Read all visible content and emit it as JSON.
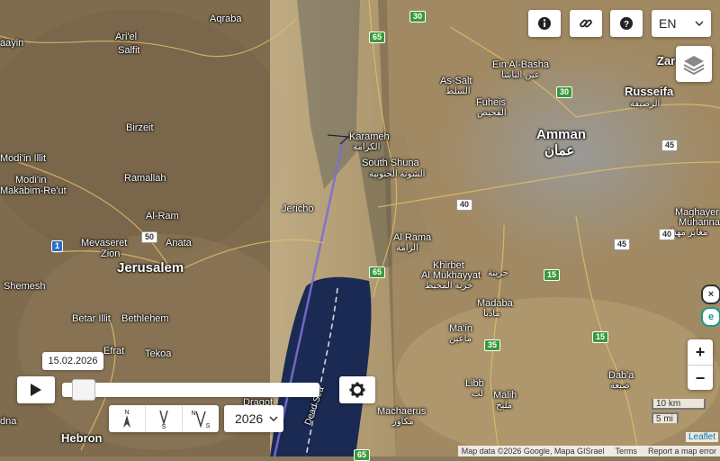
{
  "map": {
    "labels": {
      "aqraba": "Aqraba",
      "arjel": "Ari'el",
      "salfit": "Salfit",
      "ayin": "aayin",
      "birzeit": "Birzeit",
      "modin_illit": "Modi'in Illit",
      "modin": "Modi'in",
      "makabim": "Makabim-Re'ut",
      "ramallah": "Ramallah",
      "alram": "Al-Ram",
      "anata": "Anata",
      "mevaseret": "Mevaseret",
      "zion": "Zion",
      "jerusalem": "Jerusalem",
      "shemesh": "Shemesh",
      "betar": "Betar Illit",
      "bethlehem": "Bethlehem",
      "efrat": "Efrat",
      "tekoa": "Tekoa",
      "dragot": "Dragot",
      "hebron": "Hebron",
      "dna": "dna",
      "jericho": "Jericho",
      "karameh": "Karameh",
      "karameh_ar": "الكرامة",
      "southshuna": "South Shuna",
      "southshuna_ar": "الشونة الجنوبية",
      "alrama": "Al Rama",
      "alrama_ar": "الرامة",
      "khirbet": "Khirbet",
      "almukhayyat": "Al Mukhayyat",
      "khirbet_ar": "خربة المخيط",
      "jarina_ar": "جرينة",
      "madaba": "Madaba",
      "madaba_ar": "مادبا",
      "main": "Ma'in",
      "main_ar": "ماعين",
      "libb": "Libb",
      "libb_ar": "لب",
      "malih": "Malih",
      "malih_ar": "مليح",
      "machaerus": "Machaerus",
      "machaerus_ar": "مكاور",
      "deadsea": "Dead Sea",
      "einalbasha": "Ein Al-Basha",
      "einalbasha_ar": "عين الباشا",
      "assalt": "As-Salt",
      "assalt_ar": "السلط",
      "fuheis": "Fuheis",
      "fuheis_ar": "الفحيص",
      "amman": "Amman",
      "amman_ar": "عمان",
      "russeifa": "Russeifa",
      "russeifa_ar": "الرصيفة",
      "zar": "Zar",
      "maghayer": "Maghayer",
      "muhanna": "Muhanna",
      "maghayer_ar": "مغاير مهنا",
      "daba": "Dab'a",
      "daba_ar": "ضبعة"
    },
    "shields": {
      "r30a": "30",
      "r65a": "65",
      "r30b": "30",
      "r45a": "45",
      "r40a": "40",
      "r40b": "40",
      "r45b": "45",
      "r65b": "65",
      "r15a": "15",
      "r35": "35",
      "r15b": "15",
      "r50": "50",
      "r1": "1",
      "r65c": "65"
    },
    "colors": {
      "route_line": "#7b6fd0",
      "dead_sea": "#1b2a52"
    }
  },
  "toolbar": {
    "info_icon": "info-icon",
    "link_icon": "link-icon",
    "help_icon": "help-icon",
    "language": "EN"
  },
  "timeline": {
    "date": "15.02.2026",
    "position_fraction": 0.03,
    "year": "2026"
  },
  "compass": {
    "north": "N",
    "south": "S"
  },
  "scale": {
    "km": "10 km",
    "mi": "5 mi"
  },
  "attribution": {
    "map_data": "Map data ©2026 Google, Mapa GISrael",
    "terms": "Terms",
    "report": "Report a map error",
    "leaflet": "Leaflet"
  },
  "zoom": {
    "in": "+",
    "out": "−"
  }
}
